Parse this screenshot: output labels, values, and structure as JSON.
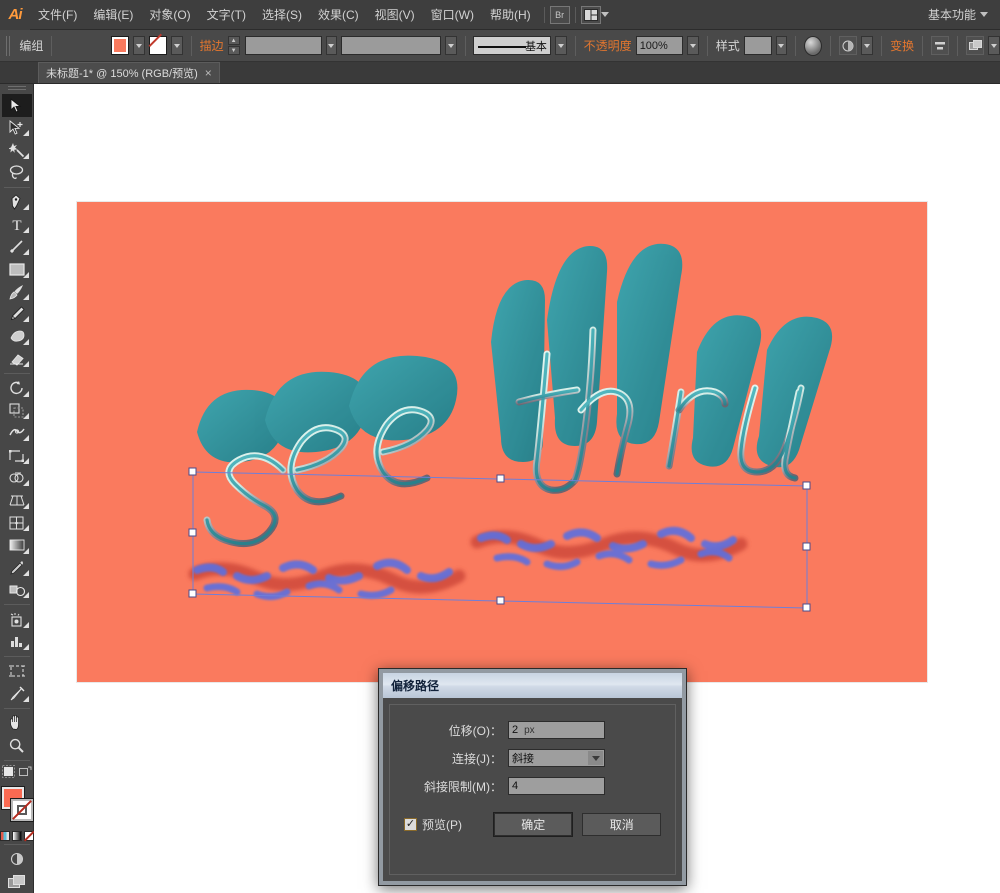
{
  "app": {
    "logo": "Ai",
    "workspace": "基本功能"
  },
  "menubar": {
    "items": [
      {
        "label": "文件(F)"
      },
      {
        "label": "编辑(E)"
      },
      {
        "label": "对象(O)"
      },
      {
        "label": "文字(T)"
      },
      {
        "label": "选择(S)"
      },
      {
        "label": "效果(C)"
      },
      {
        "label": "视图(V)"
      },
      {
        "label": "窗口(W)"
      },
      {
        "label": "帮助(H)"
      }
    ],
    "bridge_icon": "br-icon",
    "arrange_icon": "arrange-documents-icon"
  },
  "controlbar": {
    "selection_label": "编组",
    "fill_color": "#fa7a5e",
    "stroke_label": "描边",
    "stroke_weight": "",
    "stroke_profile": "基本",
    "opacity_label": "不透明度",
    "opacity_value": "100%",
    "style_label": "样式",
    "transform_label": "变换",
    "align_icon": "align-icon",
    "recolor_icon": "recolor-artwork-icon",
    "isolate_icon": "isolate-group-icon",
    "doc_setup_icon": "document-setup-icon"
  },
  "tabbar": {
    "tab_title": "未标题-1* @ 150% (RGB/预览)",
    "close": "×"
  },
  "toolbar": {
    "tools": [
      {
        "name": "selection-tool",
        "active": true
      },
      {
        "name": "direct-selection-tool",
        "active": false
      },
      {
        "name": "magic-wand-tool",
        "active": false
      },
      {
        "name": "lasso-tool",
        "active": false
      },
      {
        "name": "pen-tool",
        "active": false
      },
      {
        "name": "type-tool",
        "active": false
      },
      {
        "name": "line-segment-tool",
        "active": false
      },
      {
        "name": "rectangle-tool",
        "active": false
      },
      {
        "name": "paintbrush-tool",
        "active": false
      },
      {
        "name": "pencil-tool",
        "active": false
      },
      {
        "name": "blob-brush-tool",
        "active": false
      },
      {
        "name": "eraser-tool",
        "active": false
      },
      {
        "name": "rotate-tool",
        "active": false
      },
      {
        "name": "scale-tool",
        "active": false
      },
      {
        "name": "width-tool",
        "active": false
      },
      {
        "name": "free-transform-tool",
        "active": false
      },
      {
        "name": "shape-builder-tool",
        "active": false
      },
      {
        "name": "perspective-grid-tool",
        "active": false
      },
      {
        "name": "mesh-tool",
        "active": false
      },
      {
        "name": "gradient-tool",
        "active": false
      },
      {
        "name": "eyedropper-tool",
        "active": false
      },
      {
        "name": "blend-tool",
        "active": false
      },
      {
        "name": "symbol-sprayer-tool",
        "active": false
      },
      {
        "name": "column-graph-tool",
        "active": false
      },
      {
        "name": "artboard-tool",
        "active": false
      },
      {
        "name": "slice-tool",
        "active": false
      },
      {
        "name": "hand-tool",
        "active": false
      },
      {
        "name": "zoom-tool",
        "active": false
      }
    ],
    "fill_color": "#fa6a52",
    "stroke_color": "none",
    "color_mode_icons": [
      "color-swatch-icon",
      "gradient-swatch-icon",
      "none-swatch-icon"
    ],
    "screen_mode_icon": "screen-mode-icon",
    "draw_mode_icon": "draw-normal-icon"
  },
  "artwork": {
    "background_color": "#fa7a5e",
    "text": "see thru",
    "letter_fill": "#2a9aa6",
    "letter_highlight": "#c9efe8",
    "extrude_color": "#2b8f99",
    "selection_stroke": "#6f7fd8",
    "offset_path_color": "#d14b3a",
    "zoom": "150%"
  },
  "dialog": {
    "title": "偏移路径",
    "offset_label": "位移(O)：",
    "offset_value": "2",
    "offset_unit": "px",
    "joint_label": "连接(J)：",
    "joint_value": "斜接",
    "miter_label": "斜接限制(M)：",
    "miter_value": "4",
    "preview_label": "预览(P)",
    "preview_checked": "✓",
    "ok_label": "确定",
    "cancel_label": "取消"
  }
}
